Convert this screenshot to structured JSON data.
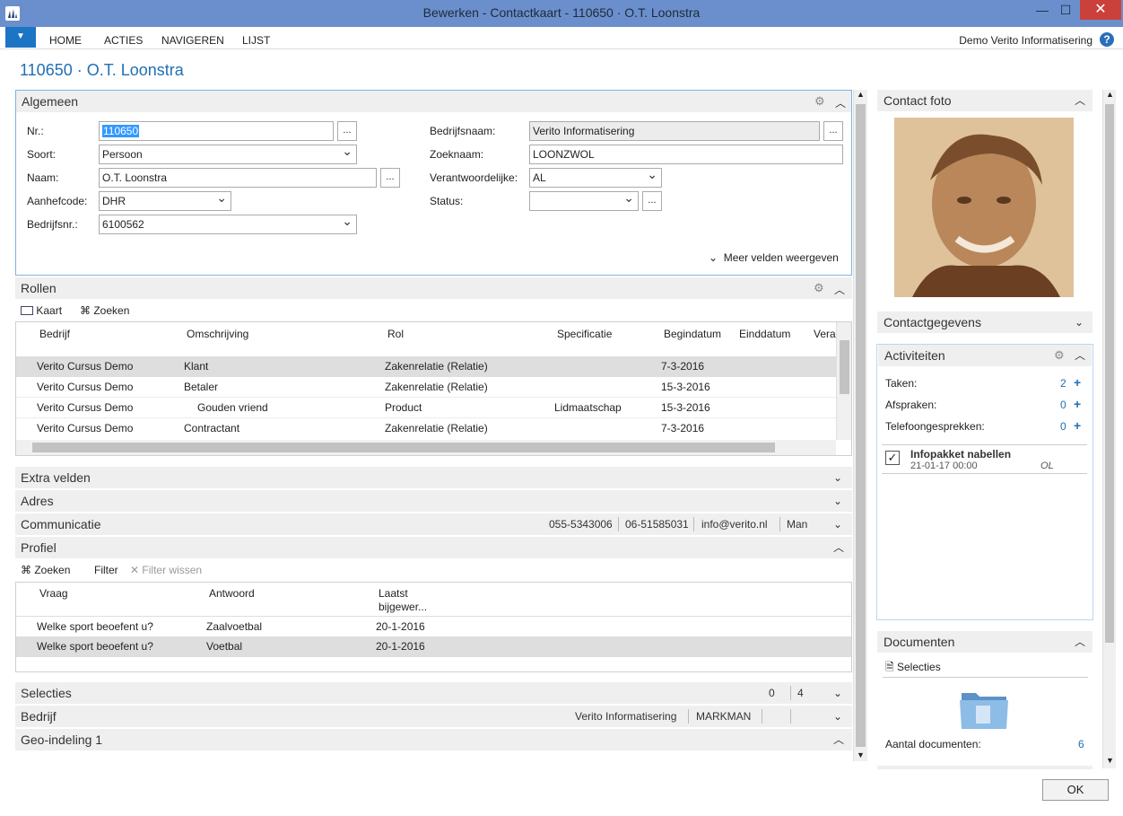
{
  "window": {
    "title": "Bewerken - Contactkaart - 110650 · O.T. Loonstra",
    "minimize": "—",
    "maximize": "☐",
    "close": "✕"
  },
  "ribbon": {
    "tabs": [
      "HOME",
      "ACTIES",
      "NAVIGEREN",
      "LIJST"
    ],
    "company": "Demo Verito Informatisering",
    "help": "?"
  },
  "page_title": "110650 · O.T. Loonstra",
  "algemeen": {
    "header": "Algemeen",
    "fields": {
      "nr_label": "Nr.:",
      "nr_value": "110650",
      "soort_label": "Soort:",
      "soort_value": "Persoon",
      "naam_label": "Naam:",
      "naam_value": "O.T. Loonstra",
      "aanhef_label": "Aanhefcode:",
      "aanhef_value": "DHR",
      "bedrijfsnr_label": "Bedrijfsnr.:",
      "bedrijfsnr_value": "6100562",
      "bedrijfsnaam_label": "Bedrijfsnaam:",
      "bedrijfsnaam_value": "Verito Informatisering",
      "zoeknaam_label": "Zoeknaam:",
      "zoeknaam_value": "LOONZWOL",
      "verantw_label": "Verantwoordelijke:",
      "verantw_value": "AL",
      "status_label": "Status:",
      "status_value": ""
    },
    "dots": "...",
    "more_fields": "Meer velden weergeven"
  },
  "rollen": {
    "header": "Rollen",
    "actions": {
      "kaart": "Kaart",
      "zoeken": "Zoeken"
    },
    "columns": [
      "Bedrijf",
      "Omschrijving",
      "Rol",
      "Specificatie",
      "Begindatum",
      "Einddatum",
      "Vera"
    ],
    "rows": [
      {
        "bedrijf": "Verito Cursus Demo",
        "omschrijving": "Klant",
        "rol": "Zakenrelatie (Relatie)",
        "spec": "",
        "begin": "7-3-2016"
      },
      {
        "bedrijf": "Verito Cursus Demo",
        "omschrijving": "Betaler",
        "rol": "Zakenrelatie (Relatie)",
        "spec": "",
        "begin": "15-3-2016"
      },
      {
        "bedrijf": "Verito Cursus Demo",
        "omschrijving": "Gouden vriend",
        "rol": "Product",
        "spec": "Lidmaatschap",
        "begin": "15-3-2016"
      },
      {
        "bedrijf": "Verito Cursus Demo",
        "omschrijving": "Contractant",
        "rol": "Zakenrelatie (Relatie)",
        "spec": "",
        "begin": "7-3-2016"
      }
    ]
  },
  "sections": {
    "extra": "Extra velden",
    "adres": "Adres",
    "communicatie": "Communicatie",
    "comm_phone": "055-5343006",
    "comm_mobile": "06-51585031",
    "comm_email": "info@verito.nl",
    "comm_gender": "Man",
    "profiel": "Profiel",
    "selecties": "Selecties",
    "sel_a": "0",
    "sel_b": "4",
    "bedrijf": "Bedrijf",
    "bedrijf_name": "Verito Informatisering",
    "bedrijf_code": "MARKMAN",
    "geo": "Geo-indeling 1"
  },
  "profiel": {
    "actions": {
      "zoeken": "Zoeken",
      "filter": "Filter",
      "filter_wissen": "Filter wissen"
    },
    "columns": {
      "vraag": "Vraag",
      "antwoord": "Antwoord",
      "laatst1": "Laatst",
      "laatst2": "bijgewer..."
    },
    "rows": [
      {
        "vraag": "Welke sport beoefent u?",
        "antwoord": "Zaalvoetbal",
        "datum": "20-1-2016"
      },
      {
        "vraag": "Welke sport beoefent u?",
        "antwoord": "Voetbal",
        "datum": "20-1-2016"
      }
    ]
  },
  "factbox": {
    "contact_foto": "Contact foto",
    "contactgegevens": "Contactgegevens",
    "activiteiten": "Activiteiten",
    "taken_label": "Taken:",
    "taken_count": "2",
    "afspraken_label": "Afspraken:",
    "afspraken_count": "0",
    "telefoon_label": "Telefoongesprekken:",
    "telefoon_count": "0",
    "activity_title": "Infopakket nabellen",
    "activity_date": "21-01-17 00:00",
    "activity_user": "OL",
    "documenten": "Documenten",
    "selecties_action": "Selecties",
    "aantal_label": "Aantal documenten:",
    "aantal_count": "6"
  },
  "ok_button": "OK",
  "colors": {
    "titlebar": "#6b8fcc",
    "accent": "#1f6fb5",
    "close": "#c9413a"
  }
}
